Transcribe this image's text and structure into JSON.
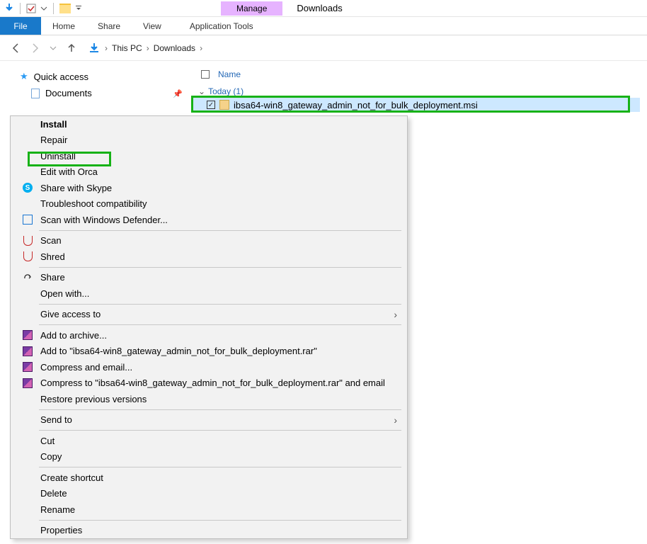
{
  "titlebar": {
    "manage": "Manage",
    "title": "Downloads"
  },
  "ribbon": {
    "file": "File",
    "home": "Home",
    "share": "Share",
    "view": "View",
    "tools": "Application Tools"
  },
  "breadcrumb": {
    "pc": "This PC",
    "folder": "Downloads"
  },
  "sidebar": {
    "quick_access": "Quick access",
    "documents": "Documents"
  },
  "content": {
    "col_name": "Name",
    "group_today": "Today (1)",
    "file_name": "ibsa64-win8_gateway_admin_not_for_bulk_deployment.msi"
  },
  "menu": {
    "install": "Install",
    "repair": "Repair",
    "uninstall": "Uninstall",
    "orca": "Edit with Orca",
    "skype": "Share with Skype",
    "tcompat": "Troubleshoot compatibility",
    "defender": "Scan with Windows Defender...",
    "scan": "Scan",
    "shred": "Shred",
    "share": "Share",
    "openwith": "Open with...",
    "giveaccess": "Give access to",
    "addarchive": "Add to archive...",
    "addto": "Add to \"ibsa64-win8_gateway_admin_not_for_bulk_deployment.rar\"",
    "compressmail": "Compress and email...",
    "compressto": "Compress to \"ibsa64-win8_gateway_admin_not_for_bulk_deployment.rar\" and email",
    "restore": "Restore previous versions",
    "sendto": "Send to",
    "cut": "Cut",
    "copy": "Copy",
    "shortcut": "Create shortcut",
    "delete": "Delete",
    "rename": "Rename",
    "properties": "Properties"
  }
}
